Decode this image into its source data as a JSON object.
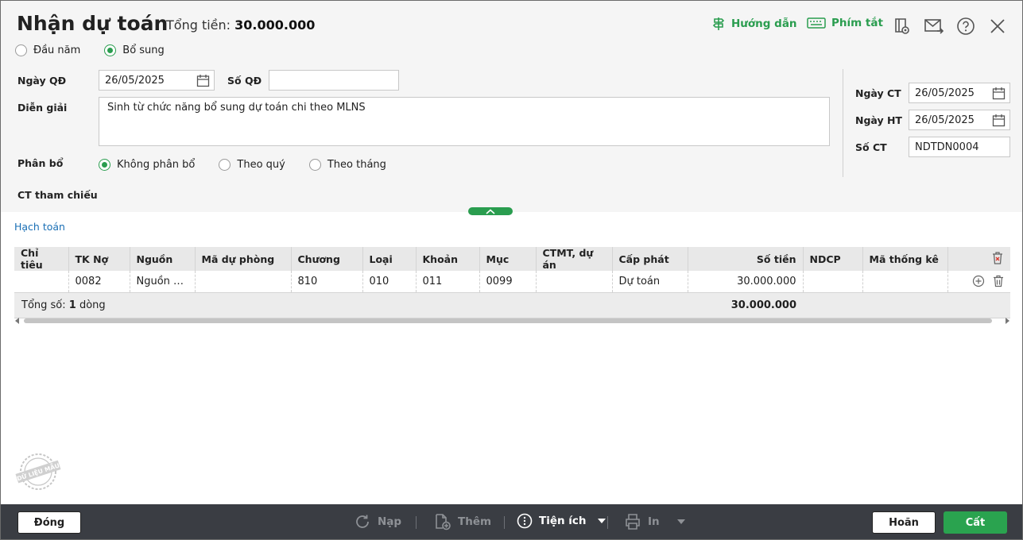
{
  "header": {
    "title": "Nhận dự toán",
    "total_label": "Tổng tiền:",
    "total_value": "30.000.000",
    "guide_label": "Hướng dẫn",
    "shortcut_label": "Phím tắt"
  },
  "type_options": [
    {
      "label": "Đầu năm",
      "selected": false
    },
    {
      "label": "Bổ sung",
      "selected": true
    }
  ],
  "form": {
    "ngay_qd_label": "Ngày QĐ",
    "ngay_qd_value": "26/05/2025",
    "so_qd_label": "Số QĐ",
    "so_qd_value": "",
    "dien_giai_label": "Diễn giải",
    "dien_giai_value": "Sinh từ chức năng bổ sung dự toán chi theo MLNS",
    "phan_bo_label": "Phân bổ",
    "phan_bo_options": [
      {
        "label": "Không phân bổ",
        "selected": true
      },
      {
        "label": "Theo quý",
        "selected": false
      },
      {
        "label": "Theo tháng",
        "selected": false
      }
    ],
    "ct_tham_chieu_label": "CT tham chiếu",
    "ngay_ct_label": "Ngày CT",
    "ngay_ct_value": "26/05/2025",
    "ngay_ht_label": "Ngày HT",
    "ngay_ht_value": "26/05/2025",
    "so_ct_label": "Số CT",
    "so_ct_value": "NDTDN0004"
  },
  "section_title": "Hạch toán",
  "table": {
    "columns": [
      "Chỉ tiêu",
      "TK Nợ",
      "Nguồn",
      "Mã dự phòng",
      "Chương",
      "Loại",
      "Khoản",
      "Mục",
      "CTMT, dự án",
      "Cấp phát",
      "Số tiền",
      "NDCP",
      "Mã thống kê"
    ],
    "rows": [
      [
        "",
        "0082",
        "Nguồn n...",
        "",
        "810",
        "010",
        "011",
        "0099",
        "",
        "Dự toán",
        "30.000.000",
        "",
        ""
      ]
    ],
    "footer_prefix": "Tổng số: ",
    "footer_count": "1",
    "footer_suffix": " dòng",
    "footer_total": "30.000.000"
  },
  "watermark_text": "DỮ LIỆU MẪU",
  "footer": {
    "close_label": "Đóng",
    "reload_label": "Nạp",
    "add_label": "Thêm",
    "utilities_label": "Tiện ích",
    "print_label": "In",
    "cancel_label": "Hoãn",
    "save_label": "Cất"
  },
  "colors": {
    "accent_green": "#2a9d4f",
    "link_blue": "#1a6fb5",
    "footer_bg": "#3a3d43"
  }
}
